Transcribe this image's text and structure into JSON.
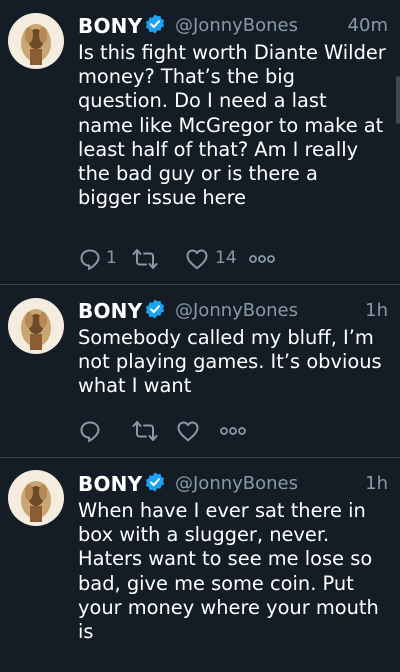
{
  "tweets": [
    {
      "name": "BONY",
      "handle": "@JonnyBones",
      "time": "40m",
      "text": "Is this fight worth Diante Wilder money? That’s the big question. Do I need a last name like McGregor to make at least half of that? Am I really the bad guy or is there a bigger issue here",
      "replies": "1",
      "retweets": "",
      "likes": "14"
    },
    {
      "name": "BONY",
      "handle": "@JonnyBones",
      "time": "1h",
      "text": "Somebody called my bluff, I’m not playing games. It’s obvious what I want",
      "replies": "",
      "retweets": "",
      "likes": ""
    },
    {
      "name": "BONY",
      "handle": "@JonnyBones",
      "time": "1h",
      "text": "When have I ever sat there in box with a slugger, never. Haters want to see me lose so bad, give me some coin. Put your money where your mouth is"
    }
  ],
  "colors": {
    "background": "#141d26",
    "divider": "#38444d",
    "secondary_text": "#8899a6",
    "verified": "#1da1f2"
  },
  "icons": [
    "reply-icon",
    "retweet-icon",
    "like-icon",
    "more-icon",
    "verified-badge-icon"
  ]
}
